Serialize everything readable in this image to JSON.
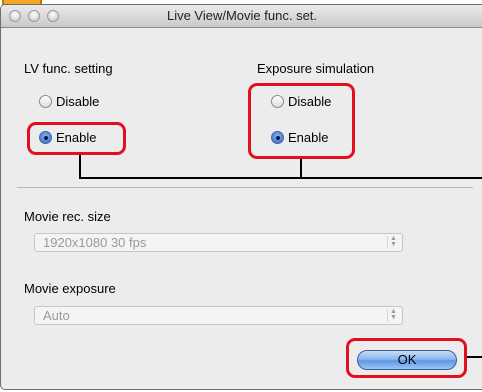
{
  "window": {
    "title": "Live View/Movie func. set."
  },
  "lv_func": {
    "heading": "LV func. setting",
    "options": [
      {
        "label": "Disable",
        "checked": false
      },
      {
        "label": "Enable",
        "checked": true
      }
    ]
  },
  "exposure_sim": {
    "heading": "Exposure simulation",
    "options": [
      {
        "label": "Disable",
        "checked": false
      },
      {
        "label": "Enable",
        "checked": true
      }
    ]
  },
  "movie_rec_size": {
    "label": "Movie rec. size",
    "value": "1920x1080 30 fps"
  },
  "movie_exposure": {
    "label": "Movie exposure",
    "value": "Auto"
  },
  "buttons": {
    "ok_label": "OK"
  },
  "colors": {
    "highlight": "#e0101f",
    "window_bg": "#ececec",
    "ok_button": "#6fa2e8"
  }
}
